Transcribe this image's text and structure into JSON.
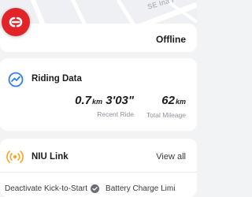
{
  "map": {
    "street_label": "SE Ina P"
  },
  "logo": {
    "icon": "niu-logo-icon",
    "color": "#e2232a"
  },
  "vehicle": {
    "status": "Offline"
  },
  "riding_data": {
    "title": "Riding Data",
    "icon": "riding-data-gauge-icon",
    "stats": [
      {
        "value": "0.7",
        "unit": "km",
        "label": ""
      },
      {
        "value": "3'03\"",
        "unit": "",
        "label": "Recent Ride"
      },
      {
        "value": "62",
        "unit": "km",
        "label": "Total Mileage"
      }
    ]
  },
  "niu_link": {
    "title": "NIU Link",
    "icon": "niu-link-signal-icon",
    "view_all": "View all",
    "shortcuts": [
      {
        "label": "Deactivate Kick-to-Start",
        "icon": "check-circle-icon"
      },
      {
        "label": "Battery Charge Limi"
      }
    ]
  },
  "colors": {
    "brand": "#e2232a",
    "accent_blue": "#2f7ee8",
    "link_orange": "#f5a623"
  }
}
